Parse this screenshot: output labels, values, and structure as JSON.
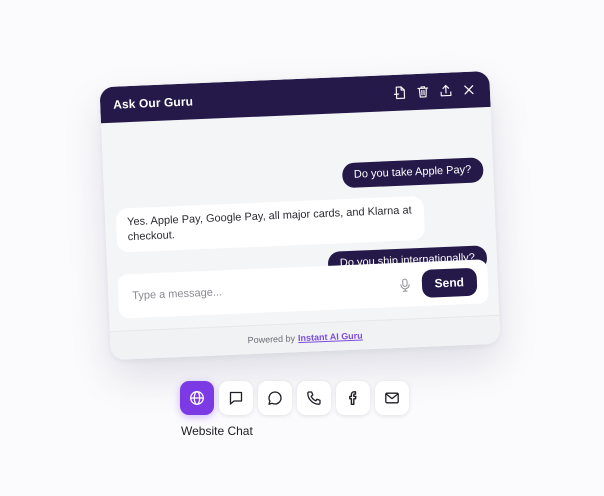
{
  "widget": {
    "title": "Ask Our Guru",
    "header_icons": [
      "new-document-icon",
      "trash-icon",
      "upload-icon",
      "close-icon"
    ],
    "messages": [
      {
        "role": "user",
        "text": "Do you take Apple Pay?"
      },
      {
        "role": "bot",
        "text": "Yes. Apple Pay, Google Pay, all major cards, and Klarna at checkout."
      },
      {
        "role": "user",
        "text": "Do you ship internationally?"
      }
    ],
    "composer": {
      "placeholder": "Type a message...",
      "send_label": "Send",
      "mic_icon": "microphone-icon"
    },
    "footer": {
      "lead": "Powered by",
      "brand": "Instant AI Guru"
    }
  },
  "channels": {
    "items": [
      {
        "icon": "globe-icon",
        "active": true
      },
      {
        "icon": "chat-square-icon",
        "active": false
      },
      {
        "icon": "chat-round-icon",
        "active": false
      },
      {
        "icon": "phone-icon",
        "active": false
      },
      {
        "icon": "facebook-icon",
        "active": false
      },
      {
        "icon": "mail-icon",
        "active": false
      }
    ],
    "active_label": "Website Chat"
  },
  "colors": {
    "header": "#25194a",
    "accent": "#7c3ae5",
    "background": "#fbfbfd"
  }
}
